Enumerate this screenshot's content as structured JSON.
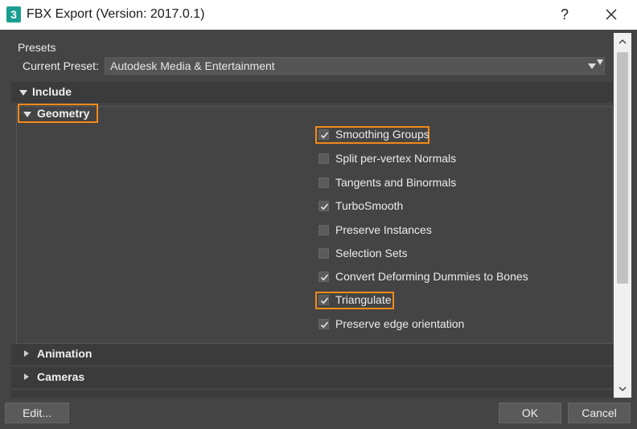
{
  "window": {
    "app_icon_glyph": "3",
    "title": "FBX Export (Version: 2017.0.1)",
    "help_glyph": "?"
  },
  "presets": {
    "section_label": "Presets",
    "current_label": "Current Preset:",
    "current_value": "Autodesk Media & Entertainment"
  },
  "sections": {
    "include": "Include",
    "geometry": "Geometry",
    "animation": "Animation",
    "cameras": "Cameras"
  },
  "geometry_options": [
    {
      "label": "Smoothing Groups",
      "checked": true,
      "highlighted": true
    },
    {
      "label": "Split per-vertex Normals",
      "checked": false,
      "highlighted": false
    },
    {
      "label": "Tangents and Binormals",
      "checked": false,
      "highlighted": false
    },
    {
      "label": "TurboSmooth",
      "checked": true,
      "highlighted": false
    },
    {
      "label": "Preserve Instances",
      "checked": false,
      "highlighted": false
    },
    {
      "label": "Selection Sets",
      "checked": false,
      "highlighted": false
    },
    {
      "label": "Convert Deforming Dummies to Bones",
      "checked": true,
      "highlighted": false
    },
    {
      "label": "Triangulate",
      "checked": true,
      "highlighted": true
    },
    {
      "label": "Preserve edge orientation",
      "checked": true,
      "highlighted": false
    }
  ],
  "buttons": {
    "edit": "Edit...",
    "ok": "OK",
    "cancel": "Cancel"
  },
  "colors": {
    "highlight": "#f08a1a",
    "panel_bg": "#444444",
    "header_bg": "#3b3b3b"
  }
}
